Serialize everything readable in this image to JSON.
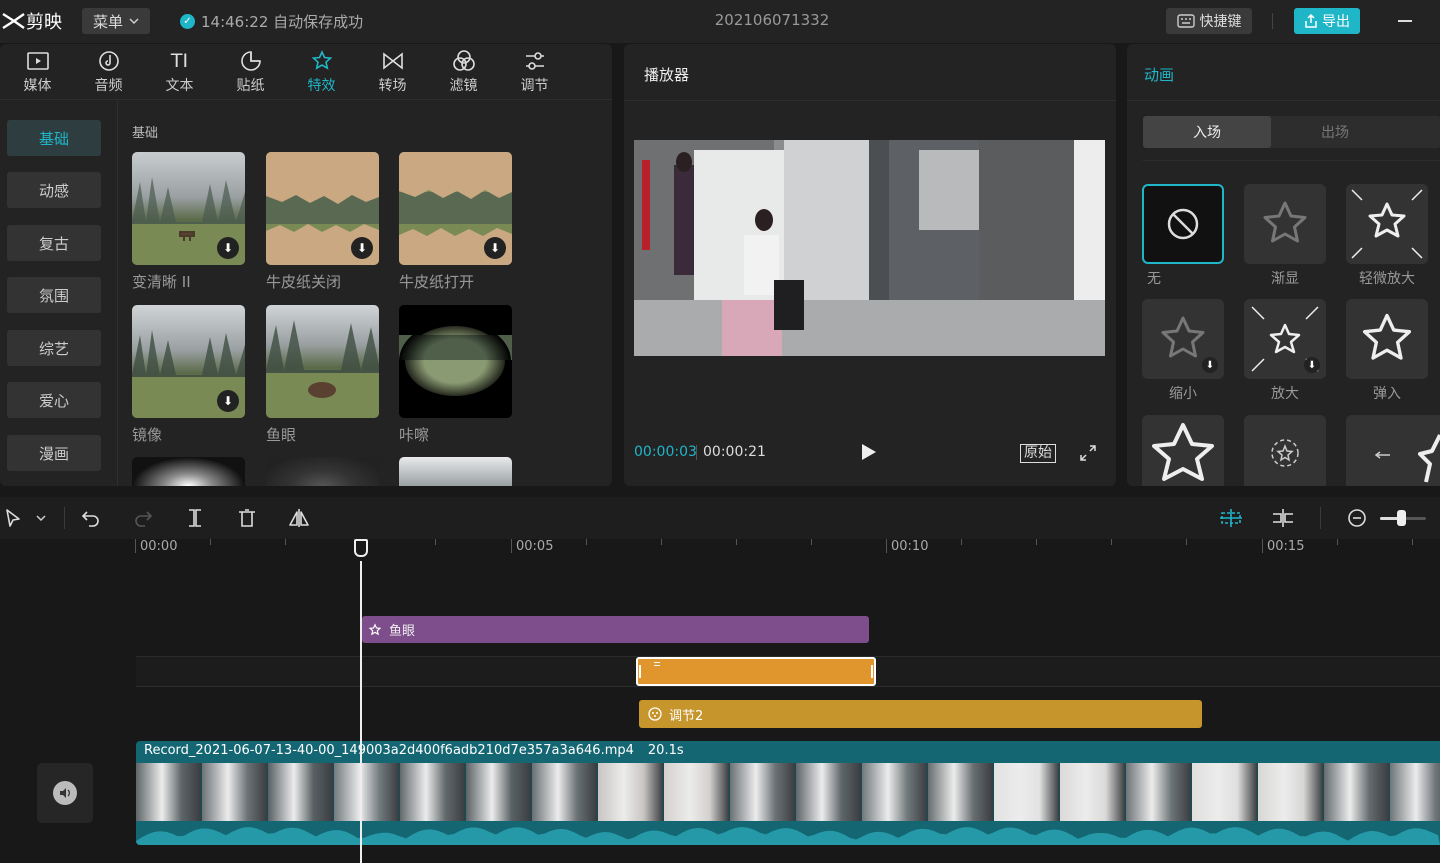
{
  "app": {
    "name": "剪映",
    "menu_label": "菜单",
    "save_status": "14:46:22 自动保存成功",
    "project_name": "202106071332",
    "hotkey_label": "快捷键",
    "export_label": "导出"
  },
  "media_tabs": [
    {
      "label": "媒体",
      "icon": "media-icon"
    },
    {
      "label": "音频",
      "icon": "audio-icon"
    },
    {
      "label": "文本",
      "icon": "text-icon"
    },
    {
      "label": "贴纸",
      "icon": "sticker-icon"
    },
    {
      "label": "特效",
      "icon": "effects-icon",
      "active": true
    },
    {
      "label": "转场",
      "icon": "transition-icon"
    },
    {
      "label": "滤镜",
      "icon": "filter-icon"
    },
    {
      "label": "调节",
      "icon": "adjust-icon"
    }
  ],
  "effect_categories": [
    "基础",
    "动感",
    "复古",
    "氛围",
    "综艺",
    "爱心",
    "漫画"
  ],
  "section_title": "基础",
  "effects": [
    {
      "label": "变清晰 II",
      "download": true
    },
    {
      "label": "牛皮纸关闭",
      "download": true
    },
    {
      "label": "牛皮纸打开",
      "download": true
    },
    {
      "label": "镜像",
      "download": true
    },
    {
      "label": "鱼眼",
      "download": false
    },
    {
      "label": "咔嚓",
      "download": false
    }
  ],
  "player": {
    "title": "播放器",
    "current_time": "00:00:03",
    "total_time": "00:00:21",
    "original_label": "原始"
  },
  "animation": {
    "title": "动画",
    "tab_in": "入场",
    "tab_out": "出场",
    "items": [
      {
        "label": "无",
        "selected": true
      },
      {
        "label": "渐显"
      },
      {
        "label": "轻微放大"
      },
      {
        "label": "缩小",
        "download": true
      },
      {
        "label": "放大",
        "download": true
      },
      {
        "label": "弹入"
      }
    ]
  },
  "timeline": {
    "ruler_labels": [
      "00:00",
      "00:05",
      "00:10",
      "00:15"
    ],
    "effect_clip": "鱼眼",
    "adjust_clip": "调节2",
    "video_clip_name": "Record_2021-06-07-13-40-00_149003a2d400f6adb210d7e357a3a646.mp4",
    "video_clip_length": "20.1s"
  },
  "colors": {
    "accent": "#1fb6c8",
    "effect_clip": "#7e4d8b",
    "adjust_clip": "#c6952c",
    "video_clip": "#136672"
  }
}
